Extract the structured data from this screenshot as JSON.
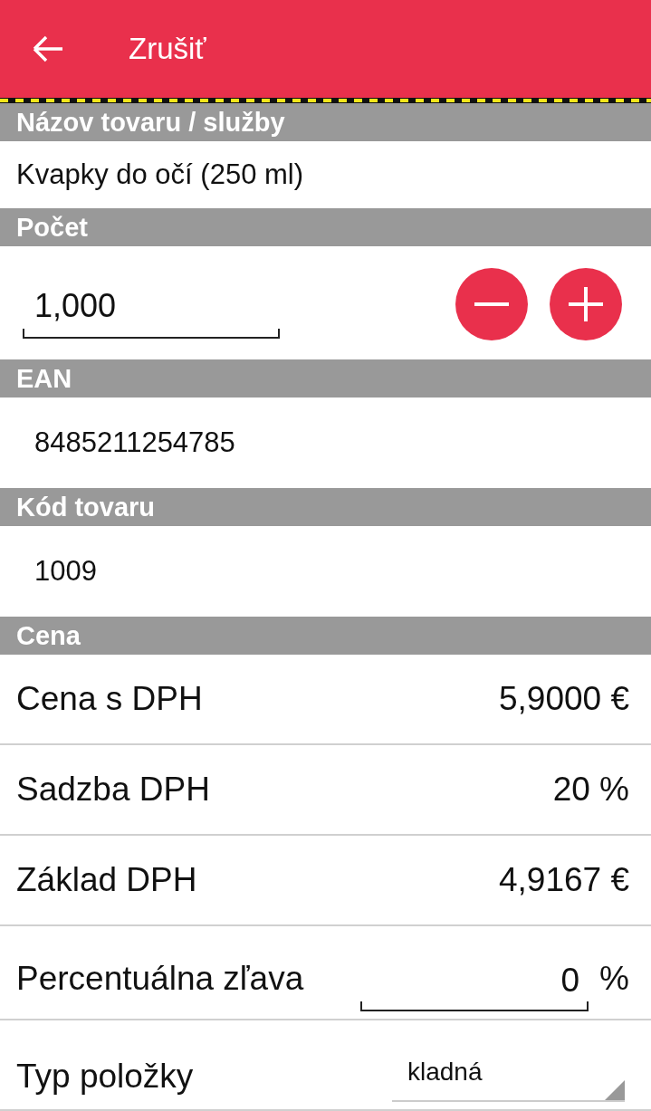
{
  "toolbar": {
    "title": "Zrušiť"
  },
  "sections": [
    {
      "header": "Názov tovaru / služby",
      "rows": [
        {
          "kind": "text",
          "value": "Kvapky do očí (250 ml)"
        }
      ]
    },
    {
      "header": "Počet",
      "rows": [
        {
          "kind": "stepper",
          "value": "1,000"
        }
      ]
    },
    {
      "header": "EAN",
      "rows": [
        {
          "kind": "field",
          "value": "8485211254785"
        }
      ]
    },
    {
      "header": "Kód tovaru",
      "rows": [
        {
          "kind": "field",
          "value": "1009"
        }
      ]
    },
    {
      "header": "Cena",
      "rows": [
        {
          "kind": "value",
          "label": "Cena s DPH",
          "value": "5,9000 €"
        },
        {
          "kind": "value",
          "label": "Sadzba DPH",
          "value": "20 %"
        },
        {
          "kind": "value",
          "label": "Základ DPH",
          "value": "4,9167 €"
        },
        {
          "kind": "input",
          "label": "Percentuálna zľava",
          "value": "0",
          "unit": "%"
        },
        {
          "kind": "dropdown",
          "label": "Typ položky",
          "value": "kladná"
        }
      ]
    }
  ]
}
